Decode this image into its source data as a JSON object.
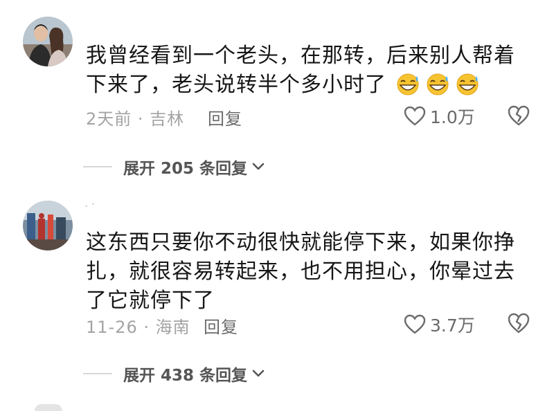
{
  "comments": [
    {
      "text": "我曾经看到一个老头，在那转，后来别人帮着下来了，老头说转半个多小时了",
      "emojis": [
        "grinning-sweat-emoji",
        "grinning-sweat-emoji",
        "grinning-sweat-emoji"
      ],
      "meta": "2天前 · 吉林",
      "reply_label": "回复",
      "likes": "1.0万",
      "expand_label": "展开 205 条回复"
    },
    {
      "username_stub": "⠂⠁",
      "text": "这东西只要你不动很快就能停下来，如果你挣扎，就很容易转起来，也不用担心，你晕过去了它就停下了",
      "meta": "11-26 · 海南",
      "reply_label": "回复",
      "likes": "3.7万",
      "expand_label": "展开 438 条回复"
    }
  ],
  "colors": {
    "text": "#161616",
    "meta": "#a3a3a3",
    "action": "#6a6a6a",
    "divider": "#d8d8d8"
  }
}
